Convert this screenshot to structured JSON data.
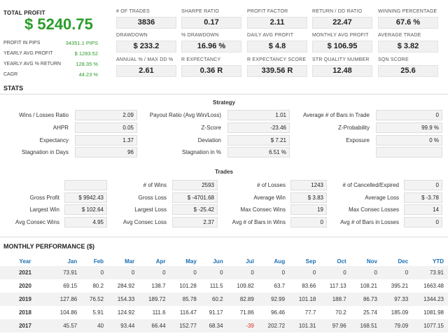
{
  "summary": {
    "total_profit_label": "TOTAL PROFIT",
    "total_profit_value": "$ 5240.75",
    "side": [
      {
        "label": "PROFIT IN PIPS",
        "value": "34351.1 PIPS"
      },
      {
        "label": "YEARLY AVG PROFIT",
        "value": "$ 1283.52"
      },
      {
        "label": "YEARLY AVG % RETURN",
        "value": "128.35 %"
      },
      {
        "label": "CAGR",
        "value": "44.23 %"
      }
    ]
  },
  "kpis": [
    {
      "label": "# OF TRADES",
      "value": "3836"
    },
    {
      "label": "SHARPE RATIO",
      "value": "0.17"
    },
    {
      "label": "PROFIT FACTOR",
      "value": "2.11"
    },
    {
      "label": "RETURN / DD RATIO",
      "value": "22.47"
    },
    {
      "label": "WINNING PERCENTAGE",
      "value": "67.6 %"
    },
    {
      "label": "DRAWDOWN",
      "value": "$ 233.2"
    },
    {
      "label": "% DRAWDOWN",
      "value": "16.96 %"
    },
    {
      "label": "DAILY AVG PROFIT",
      "value": "$ 4.8"
    },
    {
      "label": "MONTHLY AVG PROFIT",
      "value": "$ 106.95"
    },
    {
      "label": "AVERAGE TRADE",
      "value": "$ 3.82"
    },
    {
      "label": "ANNUAL % / MAX DD %",
      "value": "2.61"
    },
    {
      "label": "R EXPECTANCY",
      "value": "0.36 R"
    },
    {
      "label": "R EXPECTANCY SCORE",
      "value": "339.56 R"
    },
    {
      "label": "STR QUALITY NUMBER",
      "value": "12.48"
    },
    {
      "label": "SQN SCORE",
      "value": "25.6"
    }
  ],
  "stats_title": "STATS",
  "strategy": {
    "title": "Strategy",
    "rows": [
      [
        {
          "label": "Wins / Losses Ratio",
          "value": "2.09"
        },
        {
          "label": "Payout Ratio (Avg Win/Loss)",
          "value": "1.01"
        },
        {
          "label": "Average # of Bars in Trade",
          "value": "0"
        }
      ],
      [
        {
          "label": "AHPR",
          "value": "0.05"
        },
        {
          "label": "Z-Score",
          "value": "-23.46"
        },
        {
          "label": "Z-Probability",
          "value": "99.9 %"
        }
      ],
      [
        {
          "label": "Expectancy",
          "value": "1.37"
        },
        {
          "label": "Deviation",
          "value": "$ 7.21"
        },
        {
          "label": "Exposure",
          "value": "0 %"
        }
      ],
      [
        {
          "label": "Stagnation in Days",
          "value": "96"
        },
        {
          "label": "Stagnation in %",
          "value": "6.51 %"
        },
        {
          "label": "",
          "value": ""
        }
      ]
    ]
  },
  "trades": {
    "title": "Trades",
    "rows": [
      [
        {
          "label": "",
          "value": ""
        },
        {
          "label": "# of Wins",
          "value": "2593"
        },
        {
          "label": "# of Losses",
          "value": "1243"
        },
        {
          "label": "# of Cancelled/Expired",
          "value": "0"
        }
      ],
      [
        {
          "label": "Gross Profit",
          "value": "$ 9942.43"
        },
        {
          "label": "Gross Loss",
          "value": "$ -4701.68"
        },
        {
          "label": "Average Win",
          "value": "$ 3.83"
        },
        {
          "label": "Average Loss",
          "value": "$ -3.78"
        }
      ],
      [
        {
          "label": "Largest Win",
          "value": "$ 102.64"
        },
        {
          "label": "Largest Loss",
          "value": "$ -25.42"
        },
        {
          "label": "Max Consec Wins",
          "value": "19"
        },
        {
          "label": "Max Consec Losses",
          "value": "14"
        }
      ],
      [
        {
          "label": "Avg Consec Wins",
          "value": "4.95"
        },
        {
          "label": "Avg Consec Loss",
          "value": "2.37"
        },
        {
          "label": "Avg # of Bars in Wins",
          "value": "0"
        },
        {
          "label": "Avg # of Bars in Losses",
          "value": "0"
        }
      ]
    ]
  },
  "monthly": {
    "title": "MONTHLY PERFORMANCE ($)",
    "headers": [
      "Year",
      "Jan",
      "Feb",
      "Mar",
      "Apr",
      "May",
      "Jun",
      "Jul",
      "Aug",
      "Sep",
      "Oct",
      "Nov",
      "Dec",
      "YTD"
    ],
    "rows": [
      [
        "2021",
        "73.91",
        "0",
        "0",
        "0",
        "0",
        "0",
        "0",
        "0",
        "0",
        "0",
        "0",
        "0",
        "73.91"
      ],
      [
        "2020",
        "69.15",
        "80.2",
        "284.92",
        "138.7",
        "101.28",
        "111.5",
        "109.82",
        "63.7",
        "83.66",
        "117.13",
        "108.21",
        "395.21",
        "1663.48"
      ],
      [
        "2019",
        "127.86",
        "76.52",
        "154.33",
        "189.72",
        "85.78",
        "60.2",
        "82.89",
        "92.99",
        "101.18",
        "188.7",
        "86.73",
        "97.33",
        "1344.23"
      ],
      [
        "2018",
        "104.86",
        "5.91",
        "124.92",
        "111.6",
        "116.47",
        "91.17",
        "71.86",
        "96.46",
        "77.7",
        "70.2",
        "25.74",
        "185.09",
        "1081.98"
      ],
      [
        "2017",
        "45.57",
        "40",
        "93.44",
        "66.44",
        "152.77",
        "68.34",
        "-39",
        "202.72",
        "101.31",
        "97.96",
        "168.51",
        "79.09",
        "1077.15"
      ]
    ]
  },
  "colors": {
    "positive": "#2a9d2a",
    "negative": "#d93025",
    "header": "#1a6fb4"
  }
}
